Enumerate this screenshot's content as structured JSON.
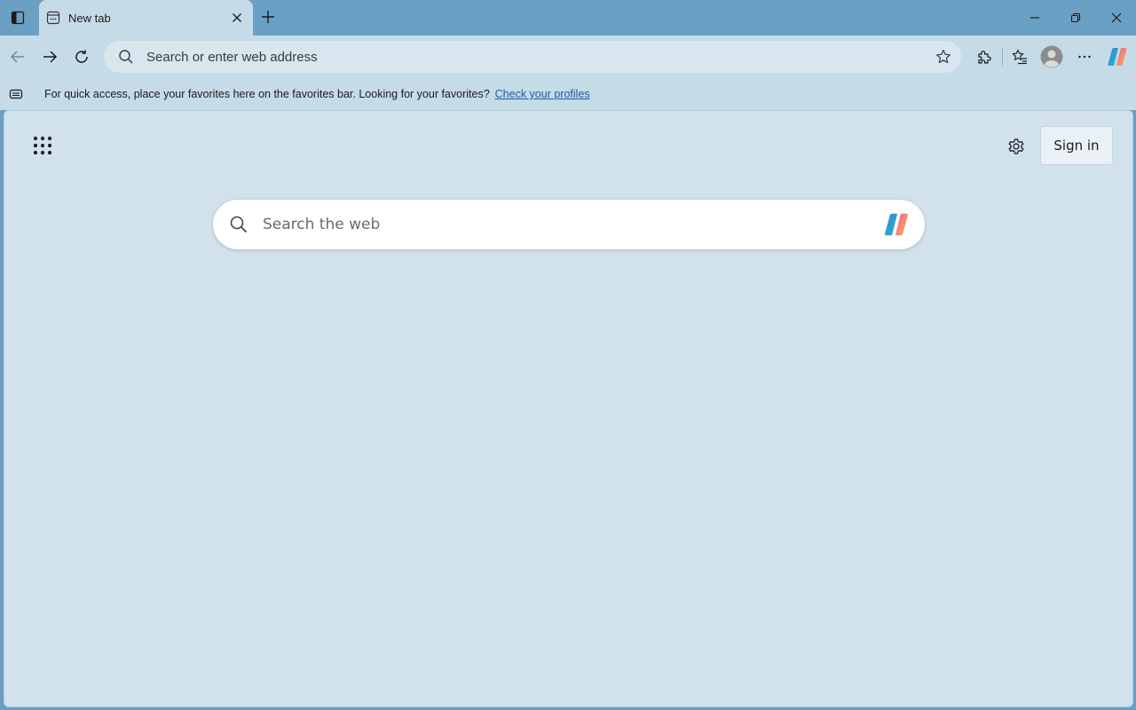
{
  "window": {
    "tab_title": "New tab"
  },
  "toolbar": {
    "address_placeholder": "Search or enter web address"
  },
  "favorites_bar": {
    "message": "For quick access, place your favorites here on the favorites bar. Looking for your favorites?",
    "link_label": "Check your profiles"
  },
  "page": {
    "sign_in_label": "Sign in",
    "search_placeholder": "Search the web"
  },
  "icons": {
    "tab_actions": "tab-actions-icon",
    "tab_favicon": "new-tab-page-icon",
    "tab_close": "close-icon",
    "new_tab": "plus-icon",
    "minimize": "minimize-icon",
    "restore": "restore-icon",
    "close_window": "close-icon",
    "back": "arrow-left-icon",
    "forward": "arrow-right-icon",
    "refresh": "refresh-icon",
    "address_search": "search-icon",
    "favorite_star": "star-icon",
    "extensions": "puzzle-icon",
    "favorites": "favorites-icon",
    "profile": "avatar-icon",
    "more": "more-icon",
    "copilot": "copilot-icon",
    "apps": "app-launcher-icon",
    "settings": "gear-icon"
  },
  "colors": {
    "titlebar": "#6aa0c4",
    "toolbar": "#c5dbe8",
    "page_background": "#d1e2ec",
    "link": "#1c5aa0"
  }
}
